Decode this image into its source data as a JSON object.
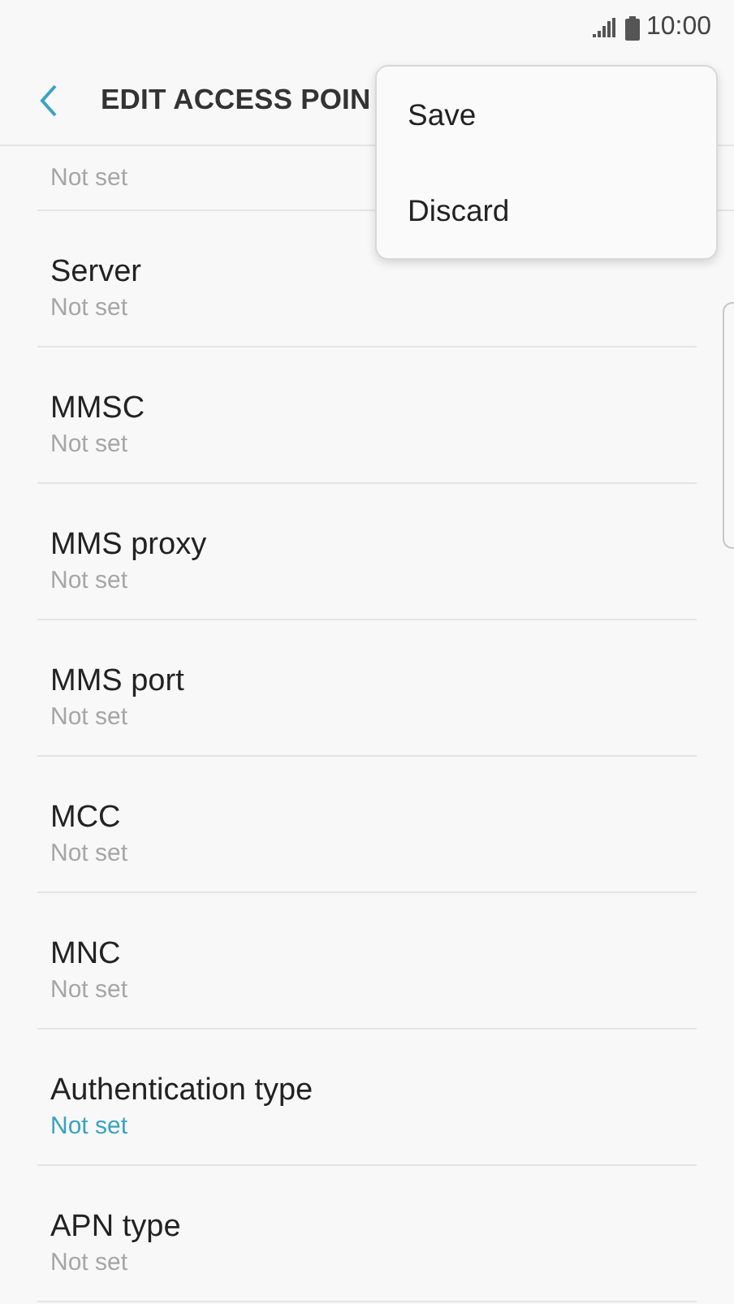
{
  "status_bar": {
    "time": "10:00"
  },
  "header": {
    "title": "EDIT ACCESS POIN"
  },
  "menu": {
    "items": [
      {
        "label": "Save"
      },
      {
        "label": "Discard"
      }
    ]
  },
  "settings": [
    {
      "value": "Not set",
      "highlighted": false
    },
    {
      "label": "Server",
      "value": "Not set",
      "highlighted": false
    },
    {
      "label": "MMSC",
      "value": "Not set",
      "highlighted": false
    },
    {
      "label": "MMS proxy",
      "value": "Not set",
      "highlighted": false
    },
    {
      "label": "MMS port",
      "value": "Not set",
      "highlighted": false
    },
    {
      "label": "MCC",
      "value": "Not set",
      "highlighted": false
    },
    {
      "label": "MNC",
      "value": "Not set",
      "highlighted": false
    },
    {
      "label": "Authentication type",
      "value": "Not set",
      "highlighted": true
    },
    {
      "label": "APN type",
      "value": "Not set",
      "highlighted": false
    }
  ]
}
